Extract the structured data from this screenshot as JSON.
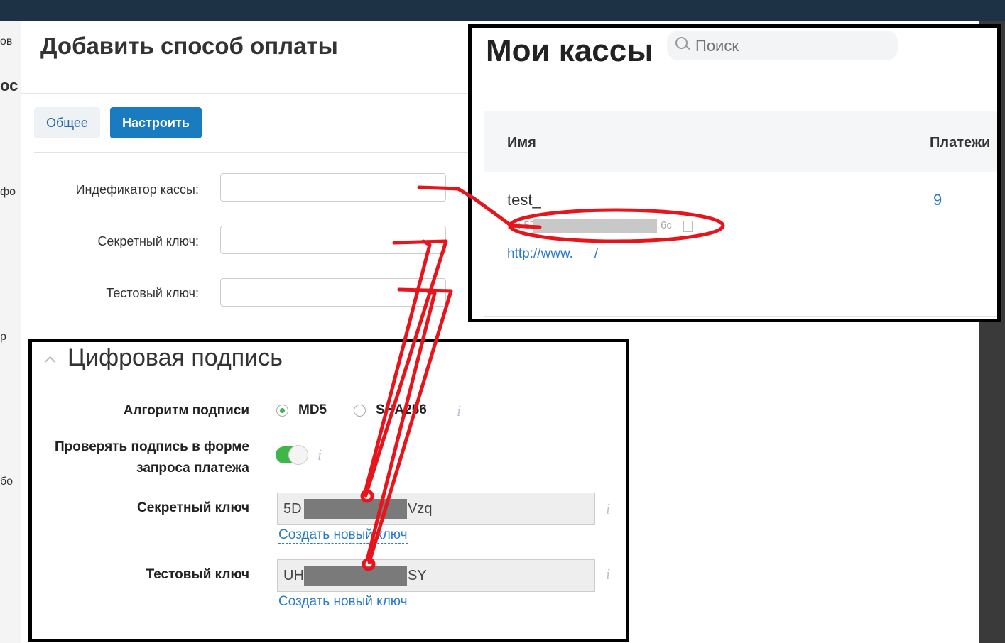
{
  "background": {
    "left_fragments": [
      "ов",
      "ос",
      "фо",
      "р",
      "бо"
    ]
  },
  "modal": {
    "title": "Добавить способ оплаты",
    "tabs": [
      {
        "label": "Общее",
        "active": false
      },
      {
        "label": "Настроить",
        "active": true
      }
    ],
    "fields": [
      {
        "label": "Индефикатор кассы:",
        "value": ""
      },
      {
        "label": "Секретный ключ:",
        "value": ""
      },
      {
        "label": "Тестовый ключ:",
        "value": ""
      }
    ]
  },
  "kassy": {
    "title": "Мои кассы",
    "search_placeholder": "Поиск",
    "columns": [
      "Имя",
      "Платежи"
    ],
    "row": {
      "name": "test_",
      "id_prefix": "ID: 57",
      "id_suffix": "6c",
      "url": "http://www.",
      "url_end": "/",
      "payments": "9"
    }
  },
  "signature": {
    "title": "Цифровая подпись",
    "algorithm_label": "Алгоритм подписи",
    "algorithms": [
      {
        "label": "MD5",
        "selected": true
      },
      {
        "label": "SHA256",
        "selected": false
      }
    ],
    "verify_label_1": "Проверять подпись в форме",
    "verify_label_2": "запроса платежа",
    "verify_enabled": true,
    "secret_label": "Секретный ключ",
    "secret_prefix": "5D",
    "secret_suffix": "Vzq",
    "test_label": "Тестовый ключ",
    "test_prefix": "UH",
    "test_suffix": "SY",
    "new_key_label": "Создать новый ключ",
    "info_glyph": "i"
  },
  "colors": {
    "accent": "#1a7bc1",
    "toggle_on": "#3fb54a",
    "annotation": "#e8141c",
    "link": "#2a7ac9"
  }
}
